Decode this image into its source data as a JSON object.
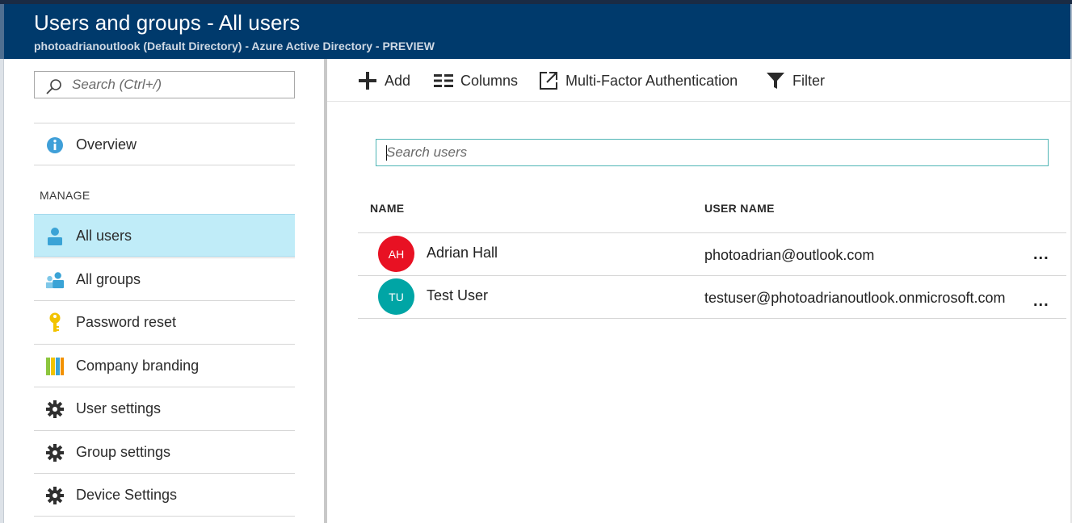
{
  "header": {
    "title": "Users and groups - All users",
    "subtitle": "photoadrianoutlook (Default Directory) - Azure Active Directory - PREVIEW",
    "background": "#003a6c"
  },
  "sidebar": {
    "search_placeholder": "Search (Ctrl+/)",
    "overview_label": "Overview",
    "section_label": "MANAGE",
    "items": [
      {
        "label": "All users",
        "icon": "user-icon",
        "active": true
      },
      {
        "label": "All groups",
        "icon": "group-icon",
        "active": false
      },
      {
        "label": "Password reset",
        "icon": "key-icon",
        "active": false
      },
      {
        "label": "Company branding",
        "icon": "branding-icon",
        "active": false
      },
      {
        "label": "User settings",
        "icon": "gear-icon",
        "active": false
      },
      {
        "label": "Group settings",
        "icon": "gear-icon",
        "active": false
      },
      {
        "label": "Device Settings",
        "icon": "gear-icon",
        "active": false
      }
    ],
    "active_color": "#c0ecf8"
  },
  "toolbar": {
    "add_label": "Add",
    "columns_label": "Columns",
    "mfa_label": "Multi-Factor Authentication",
    "filter_label": "Filter"
  },
  "user_search": {
    "placeholder": "Search users"
  },
  "table": {
    "columns": [
      "NAME",
      "USER NAME"
    ],
    "rows": [
      {
        "initials": "AH",
        "name": "Adrian Hall",
        "username": "photoadrian@outlook.com",
        "avatar_color": "#e81123",
        "more": "..."
      },
      {
        "initials": "TU",
        "name": "Test User",
        "username": "testuser@photoadrianoutlook.onmicrosoft.com",
        "avatar_color": "#00a5a5",
        "more": "..."
      }
    ]
  }
}
